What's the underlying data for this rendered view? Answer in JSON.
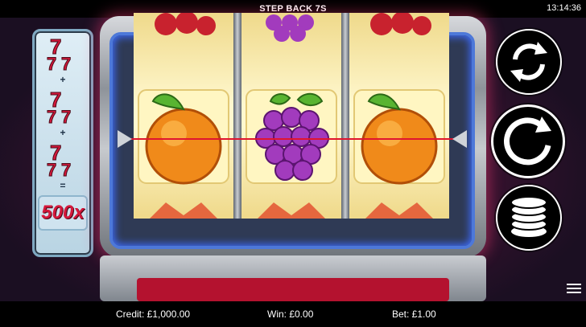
{
  "header": {
    "title": "STEP BACK 7S",
    "clock": "13:14:36"
  },
  "paytable": {
    "plus_1": "+",
    "plus_2": "+",
    "equals": "=",
    "multiplier": "500x"
  },
  "reels": [
    {
      "top": "cherries",
      "center": "orange",
      "bottom": "jester"
    },
    {
      "top": "grapes",
      "center": "grapes",
      "bottom": "jester"
    },
    {
      "top": "cherries",
      "center": "orange",
      "bottom": "jester"
    }
  ],
  "controls": {
    "autoplay_icon": "autoplay-icon",
    "spin_icon": "spin-icon",
    "bet_icon": "coin-stack-icon",
    "menu_icon": "hamburger-menu-icon"
  },
  "status": {
    "credit": "Credit: £1,000.00",
    "win": "Win: £0.00",
    "bet": "Bet: £1.00"
  },
  "colors": {
    "payline": "#e0152f",
    "seven_red": "#d4183b",
    "frame_blue": "#4d78d9"
  }
}
